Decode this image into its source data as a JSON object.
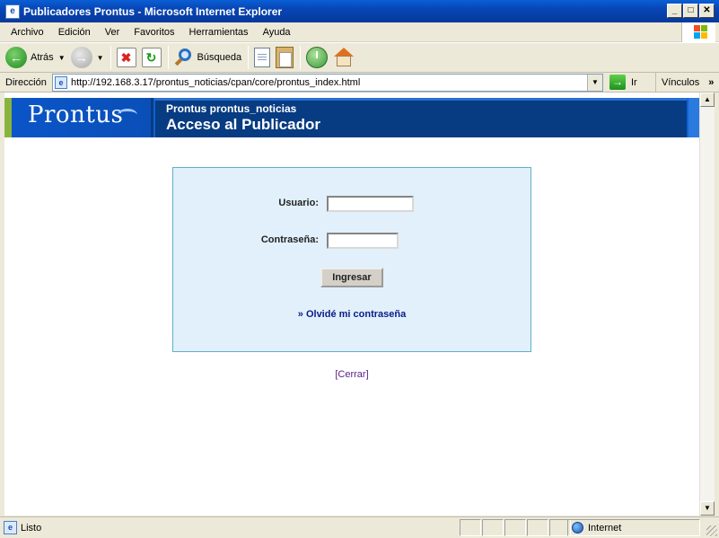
{
  "window": {
    "title": "Publicadores Prontus - Microsoft Internet Explorer"
  },
  "menu": [
    "Archivo",
    "Edición",
    "Ver",
    "Favoritos",
    "Herramientas",
    "Ayuda"
  ],
  "toolbar": {
    "back_label": "Atrás",
    "search_label": "Búsqueda"
  },
  "address": {
    "label": "Dirección",
    "url": "http://192.168.3.17/prontus_noticias/cpan/core/prontus_index.html",
    "go_label": "Ir",
    "links_label": "Vínculos"
  },
  "page": {
    "logo": "Prontus",
    "subtitle": "Prontus prontus_noticias",
    "title": "Acceso al Publicador",
    "login": {
      "user_label": "Usuario:",
      "user_value": "",
      "password_label": "Contraseña:",
      "password_value": "",
      "submit_label": "Ingresar",
      "forgot_label": "» Olvidé mi contraseña"
    },
    "close_link": "[Cerrar]"
  },
  "status": {
    "text": "Listo",
    "zone": "Internet"
  },
  "colors": {
    "header_bg": "#073b82",
    "login_bg": "#e1f0fa",
    "login_border": "#5fb1c8",
    "link": "#0a1c8a"
  }
}
